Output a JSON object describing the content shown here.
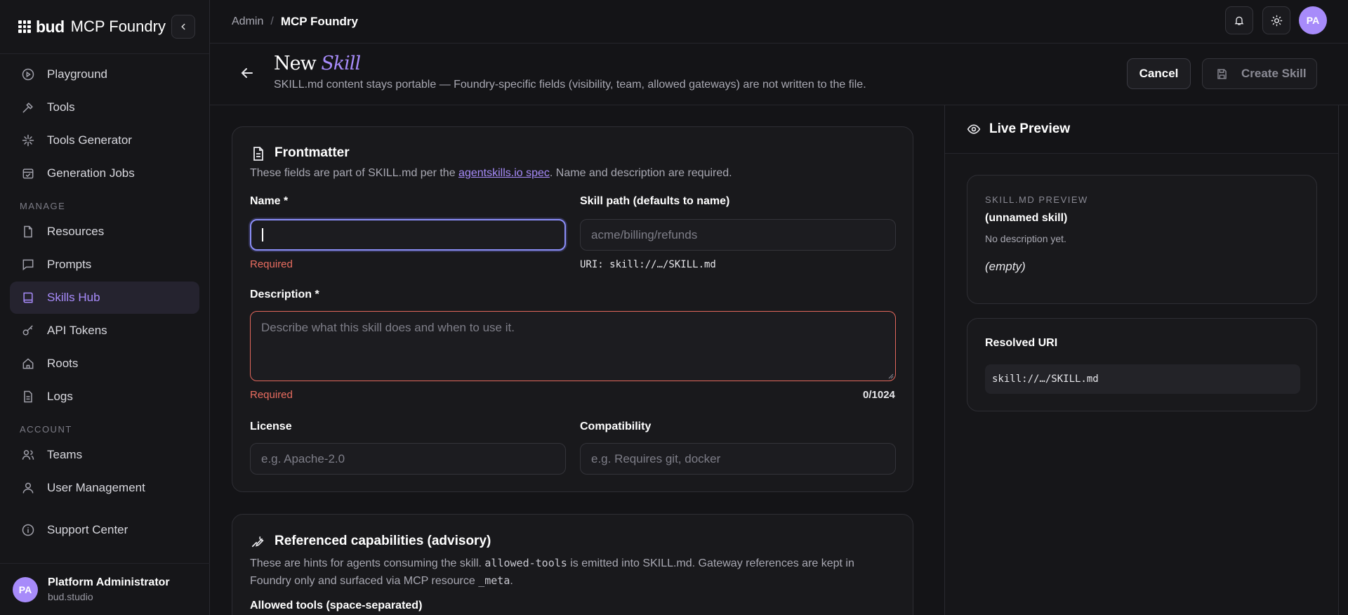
{
  "brand": {
    "name": "bud",
    "product": "MCP Foundry"
  },
  "sidebar": {
    "items": [
      {
        "label": "Playground",
        "icon": "play-circle-icon"
      },
      {
        "label": "Tools",
        "icon": "wrench-icon"
      },
      {
        "label": "Tools Generator",
        "icon": "sparkle-icon"
      },
      {
        "label": "Generation Jobs",
        "icon": "calendar-check-icon"
      }
    ],
    "manage_label": "MANAGE",
    "manage_items": [
      {
        "label": "Resources",
        "icon": "file-icon"
      },
      {
        "label": "Prompts",
        "icon": "chat-icon"
      },
      {
        "label": "Skills Hub",
        "icon": "book-icon",
        "active": true
      },
      {
        "label": "API Tokens",
        "icon": "key-icon"
      },
      {
        "label": "Roots",
        "icon": "home-icon"
      },
      {
        "label": "Logs",
        "icon": "document-icon"
      }
    ],
    "account_label": "ACCOUNT",
    "account_items": [
      {
        "label": "Teams",
        "icon": "users-icon"
      },
      {
        "label": "User Management",
        "icon": "user-icon"
      }
    ],
    "support": {
      "label": "Support Center",
      "icon": "info-icon"
    },
    "user": {
      "initials": "PA",
      "name": "Platform Administrator",
      "org": "bud.studio"
    }
  },
  "topbar": {
    "breadcrumb_root": "Admin",
    "breadcrumb_sep": "/",
    "breadcrumb_current": "MCP Foundry",
    "avatar_initials": "PA"
  },
  "header": {
    "title_plain": "New",
    "title_accent": "Skill",
    "subtitle": "SKILL.md content stays portable — Foundry-specific fields (visibility, team, allowed gateways) are not written to the file.",
    "cancel_label": "Cancel",
    "create_label": "Create Skill"
  },
  "frontmatter": {
    "title": "Frontmatter",
    "desc_pre": "These fields are part of SKILL.md per the ",
    "desc_link": "agentskills.io spec",
    "desc_post": ". Name and description are required.",
    "name_label": "Name *",
    "name_value": "",
    "name_error": "Required",
    "path_label": "Skill path (defaults to name)",
    "path_placeholder": "acme/billing/refunds",
    "uri_hint": "URI: skill://…/SKILL.md",
    "description_label": "Description *",
    "description_placeholder": "Describe what this skill does and when to use it.",
    "description_error": "Required",
    "description_counter": "0/1024",
    "license_label": "License",
    "license_placeholder": "e.g. Apache-2.0",
    "compat_label": "Compatibility",
    "compat_placeholder": "e.g. Requires git, docker"
  },
  "capabilities": {
    "title": "Referenced capabilities (advisory)",
    "desc_1": "These are hints for agents consuming the skill. ",
    "desc_code_1": "allowed-tools",
    "desc_2": " is emitted into SKILL.md. Gateway references are kept in",
    "desc_3": "Foundry only and surfaced via MCP resource ",
    "desc_code_2": "_meta",
    "desc_4": ".",
    "allowed_tools_label": "Allowed tools (space-separated)"
  },
  "preview": {
    "title": "Live Preview",
    "kicker": "SKILL.MD PREVIEW",
    "skill_name": "(unnamed skill)",
    "skill_desc": "No description yet.",
    "body": "(empty)",
    "resolved_title": "Resolved URI",
    "resolved_uri": "skill://…/SKILL.md"
  },
  "colors": {
    "accent": "#a78bfa",
    "error": "#ea6d60",
    "focus": "#8b8ef7"
  }
}
